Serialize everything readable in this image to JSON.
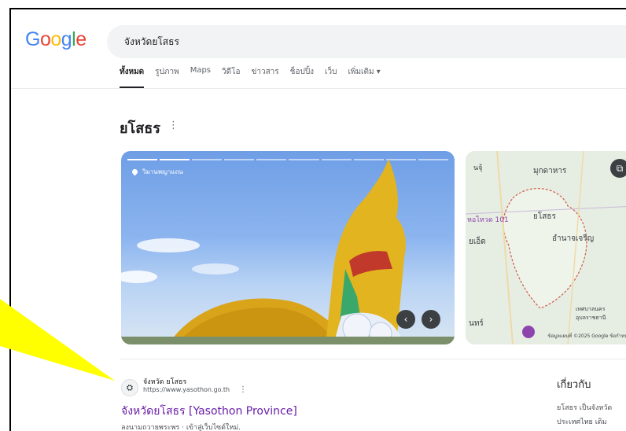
{
  "logo": {
    "letters": [
      "G",
      "o",
      "o",
      "g",
      "l",
      "e"
    ],
    "colors": [
      "#4285F4",
      "#EA4335",
      "#FBBC05",
      "#4285F4",
      "#34A853",
      "#EA4335"
    ]
  },
  "search": {
    "query": "จังหวัดยโสธร"
  },
  "tabs": [
    "ทั้งหมด",
    "รูปภาพ",
    "Maps",
    "วิดีโอ",
    "ข่าวสาร",
    "ช็อปปิ้ง",
    "เว็บ",
    "เพิ่มเติม ▾"
  ],
  "entity": {
    "title": "ยโสธร",
    "more_icon": "⋮"
  },
  "photo": {
    "location": "วิมานพญาแถน",
    "prev": "‹",
    "next": "›"
  },
  "map": {
    "labels": {
      "top": "มุกดาหาร",
      "left1": "นจุ้",
      "center": "ยโสธร",
      "left2": "ยเอ็ด",
      "right": "อำนาจเจริญ",
      "road": "หอไหวด 101",
      "bottom": "นทร์",
      "br": "เทศบาลนคร อุบลราชธานี"
    },
    "footer": "ข้อมูลแผนที่ ©2025 Google  ข้อกำหนด"
  },
  "result": {
    "site_name": "จังหวัด ยโสธร",
    "url": "https://www.yasothon.go.th",
    "menu": "⋮",
    "title": "จังหวัดยโสธร [Yasothon Province]",
    "snippet": "ลงนามถวายพระพร · เข้าสู่เว็บไซต์ใหม่."
  },
  "about": {
    "title": "เกี่ยวกับ",
    "line1": "ยโสธร เป็นจังหวัด",
    "line2": "ประเทศไทย เดิม"
  },
  "callout_color": "#ffff00"
}
